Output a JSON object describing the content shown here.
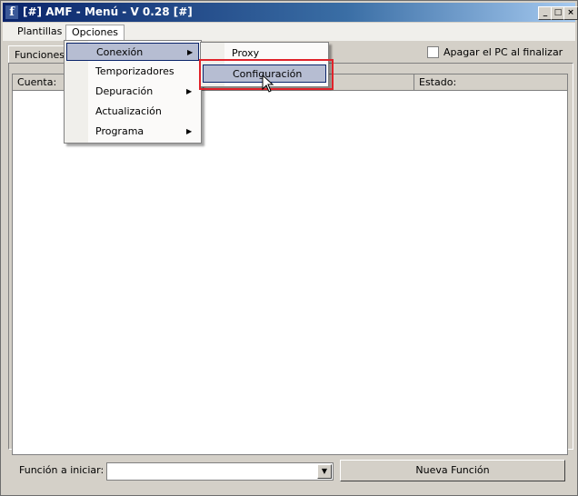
{
  "window": {
    "title": "[#] AMF - Menú - V 0.28 [#]",
    "icon": "facebook-icon",
    "icon_glyph": "f",
    "minimize_glyph": "_",
    "maximize_glyph": "□",
    "close_glyph": "×"
  },
  "menubar": {
    "items": [
      {
        "label": "Plantillas"
      },
      {
        "label": "Opciones"
      }
    ]
  },
  "opciones_menu": {
    "items": [
      {
        "label": "Conexión",
        "submenu": true,
        "selected": true
      },
      {
        "label": "Temporizadores",
        "submenu": false
      },
      {
        "label": "Depuración",
        "submenu": true
      },
      {
        "label": "Actualización",
        "submenu": false
      },
      {
        "label": "Programa",
        "submenu": true
      }
    ]
  },
  "conexion_submenu": {
    "items": [
      {
        "label": "Proxy"
      },
      {
        "label": "Configuración",
        "selected": true
      }
    ]
  },
  "tab": {
    "label": "Funciones P"
  },
  "checkbox": {
    "label": "Apagar el PC al finalizar",
    "checked": false
  },
  "list": {
    "columns": [
      {
        "label": "Cuenta:"
      },
      {
        "label": ""
      },
      {
        "label": "Estado:"
      }
    ],
    "rows": []
  },
  "bottom": {
    "funcion_label": "Función a iniciar:",
    "funcion_value": "",
    "nueva_button": "Nueva Función"
  },
  "colors": {
    "titlebar_start": "#0a246a",
    "menu_highlight": "#b6bdd2",
    "annotation_red": "#e0222a"
  }
}
